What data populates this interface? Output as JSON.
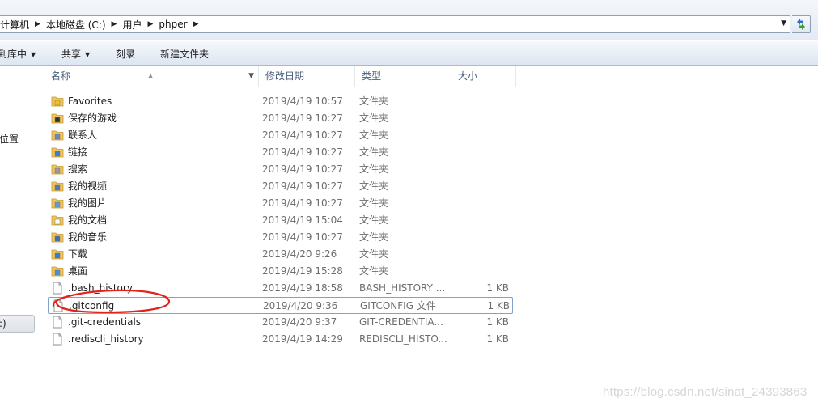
{
  "address_bar": {
    "breadcrumbs": [
      "计算机",
      "本地磁盘 (C:)",
      "用户",
      "phper"
    ]
  },
  "toolbar": {
    "include_in_library": "到库中",
    "share": "共享",
    "burn": "刻录",
    "new_folder": "新建文件夹"
  },
  "nav": {
    "partial_label_1": "位置",
    "partial_label_2": ":)"
  },
  "columns": {
    "name": "名称",
    "modified": "修改日期",
    "type": "类型",
    "size": "大小"
  },
  "files": [
    {
      "name": "Favorites",
      "modified": "2019/4/19 10:57",
      "type": "文件夹",
      "size": "",
      "icon": "favorites-folder-icon",
      "kind": "folder"
    },
    {
      "name": "保存的游戏",
      "modified": "2019/4/19 10:27",
      "type": "文件夹",
      "size": "",
      "icon": "saved-games-folder-icon",
      "kind": "folder"
    },
    {
      "name": "联系人",
      "modified": "2019/4/19 10:27",
      "type": "文件夹",
      "size": "",
      "icon": "contacts-folder-icon",
      "kind": "folder"
    },
    {
      "name": "链接",
      "modified": "2019/4/19 10:27",
      "type": "文件夹",
      "size": "",
      "icon": "links-folder-icon",
      "kind": "folder"
    },
    {
      "name": "搜索",
      "modified": "2019/4/19 10:27",
      "type": "文件夹",
      "size": "",
      "icon": "searches-folder-icon",
      "kind": "folder"
    },
    {
      "name": "我的视频",
      "modified": "2019/4/19 10:27",
      "type": "文件夹",
      "size": "",
      "icon": "videos-folder-icon",
      "kind": "folder"
    },
    {
      "name": "我的图片",
      "modified": "2019/4/19 10:27",
      "type": "文件夹",
      "size": "",
      "icon": "pictures-folder-icon",
      "kind": "folder"
    },
    {
      "name": "我的文档",
      "modified": "2019/4/19 15:04",
      "type": "文件夹",
      "size": "",
      "icon": "documents-folder-icon",
      "kind": "folder"
    },
    {
      "name": "我的音乐",
      "modified": "2019/4/19 10:27",
      "type": "文件夹",
      "size": "",
      "icon": "music-folder-icon",
      "kind": "folder"
    },
    {
      "name": "下载",
      "modified": "2019/4/20 9:26",
      "type": "文件夹",
      "size": "",
      "icon": "downloads-folder-icon",
      "kind": "folder"
    },
    {
      "name": "桌面",
      "modified": "2019/4/19 15:28",
      "type": "文件夹",
      "size": "",
      "icon": "desktop-folder-icon",
      "kind": "folder"
    },
    {
      "name": ".bash_history",
      "modified": "2019/4/19 18:58",
      "type": "BASH_HISTORY ...",
      "size": "1 KB",
      "icon": "file-icon",
      "kind": "file"
    },
    {
      "name": ".gitconfig",
      "modified": "2019/4/20 9:36",
      "type": "GITCONFIG 文件",
      "size": "1 KB",
      "icon": "file-icon",
      "kind": "file",
      "selected": true
    },
    {
      "name": ".git-credentials",
      "modified": "2019/4/20 9:37",
      "type": "GIT-CREDENTIA...",
      "size": "1 KB",
      "icon": "file-icon",
      "kind": "file"
    },
    {
      "name": ".rediscli_history",
      "modified": "2019/4/19 14:29",
      "type": "REDISCLI_HISTO...",
      "size": "1 KB",
      "icon": "file-icon",
      "kind": "file"
    }
  ],
  "colors": {
    "annotation": "#e2231a",
    "folder": "#f1c660",
    "selection_border": "#7da2ce"
  },
  "watermark": "https://blog.csdn.net/sinat_24393863"
}
